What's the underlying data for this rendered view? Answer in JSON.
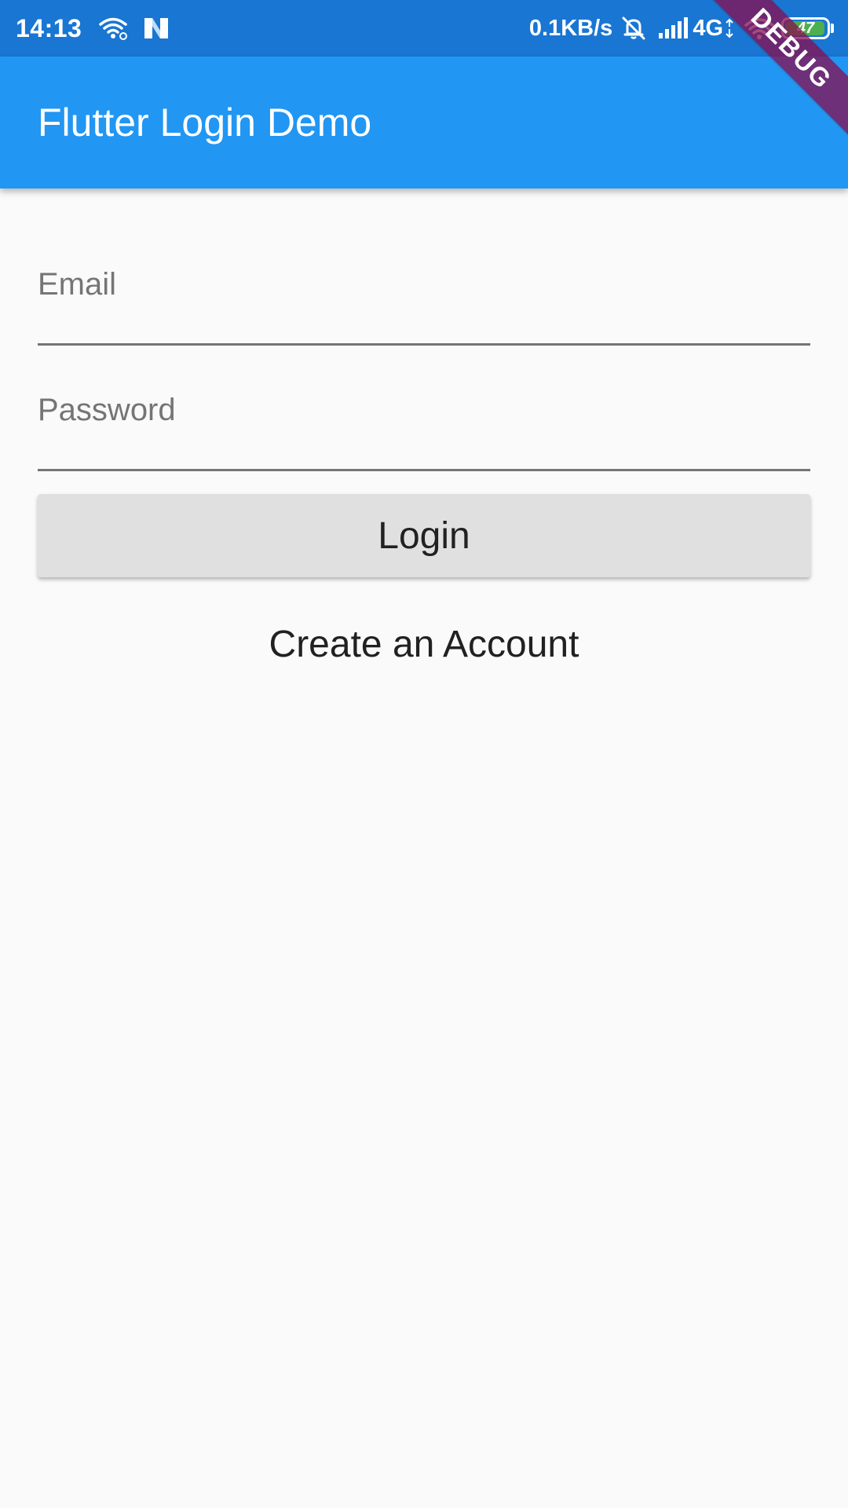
{
  "status_bar": {
    "time": "14:13",
    "net_speed": "0.1KB/s",
    "network": "4G",
    "battery": "47",
    "battery_level_percent": 47,
    "icons": [
      "wifi-link-icon",
      "n-app-icon",
      "alarm-off-icon",
      "signal-bars-icon",
      "wifi-icon",
      "battery-icon"
    ]
  },
  "app_bar": {
    "title": "Flutter Login Demo"
  },
  "debug_banner": "DEBUG",
  "form": {
    "email_label": "Email",
    "password_label": "Password",
    "login_label": "Login",
    "create_account_label": "Create an Account"
  },
  "colors": {
    "status_bar": "#1976d2",
    "app_bar": "#2196f3",
    "background": "#fafafa",
    "button": "#e0e0e0",
    "debug_banner": "#880e4f",
    "battery_fill": "#4caf50"
  }
}
